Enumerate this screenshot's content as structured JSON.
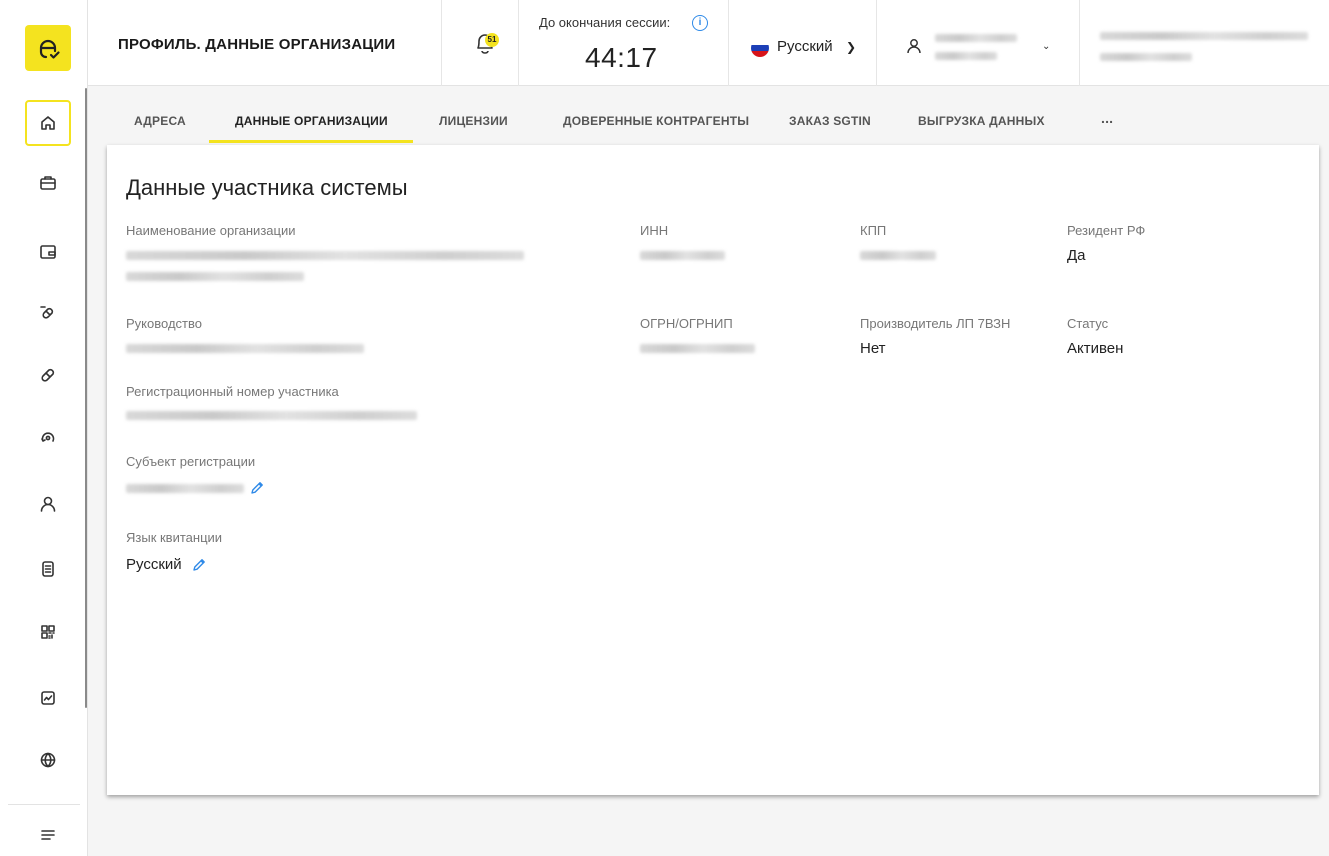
{
  "header": {
    "page_title": "ПРОФИЛЬ. ДАННЫЕ ОРГАНИЗАЦИИ",
    "notifications_count": "51",
    "session_label": "До окончания сессии:",
    "session_timer": "44:17",
    "language": "Русский"
  },
  "sidebar": {
    "items": [
      {
        "icon": "home-icon",
        "active": true
      },
      {
        "icon": "briefcase-icon"
      },
      {
        "icon": "wallet-icon"
      },
      {
        "icon": "pill-cancel-icon"
      },
      {
        "icon": "pill-icon"
      },
      {
        "icon": "refresh-icon"
      },
      {
        "icon": "user-icon"
      },
      {
        "icon": "document-list-icon"
      },
      {
        "icon": "qr-code-icon"
      },
      {
        "icon": "chart-icon"
      },
      {
        "icon": "globe-icon"
      },
      {
        "icon": "menu-icon"
      }
    ]
  },
  "tabs": [
    {
      "label": "АДРЕСА"
    },
    {
      "label": "ДАННЫЕ ОРГАНИЗАЦИИ",
      "active": true
    },
    {
      "label": "ЛИЦЕНЗИИ"
    },
    {
      "label": "ДОВЕРЕННЫЕ КОНТРАГЕНТЫ"
    },
    {
      "label": "ЗАКАЗ SGTIN"
    },
    {
      "label": "ВЫГРУЗКА ДАННЫХ"
    },
    {
      "label": "..."
    }
  ],
  "card": {
    "title": "Данные участника системы",
    "fields": {
      "org_name_label": "Наименование организации",
      "inn_label": "ИНН",
      "kpp_label": "КПП",
      "resident_label": "Резидент РФ",
      "resident_value": "Да",
      "management_label": "Руководство",
      "ogrn_label": "ОГРН/ОГРНИП",
      "producer_label": "Производитель ЛП 7ВЗН",
      "producer_value": "Нет",
      "status_label": "Статус",
      "status_value": "Активен",
      "reg_number_label": "Регистрационный номер участника",
      "subject_label": "Субъект регистрации",
      "receipt_lang_label": "Язык квитанции",
      "receipt_lang_value": "Русский"
    }
  },
  "colors": {
    "accent": "#f4e31f",
    "link": "#2f8ae8"
  }
}
